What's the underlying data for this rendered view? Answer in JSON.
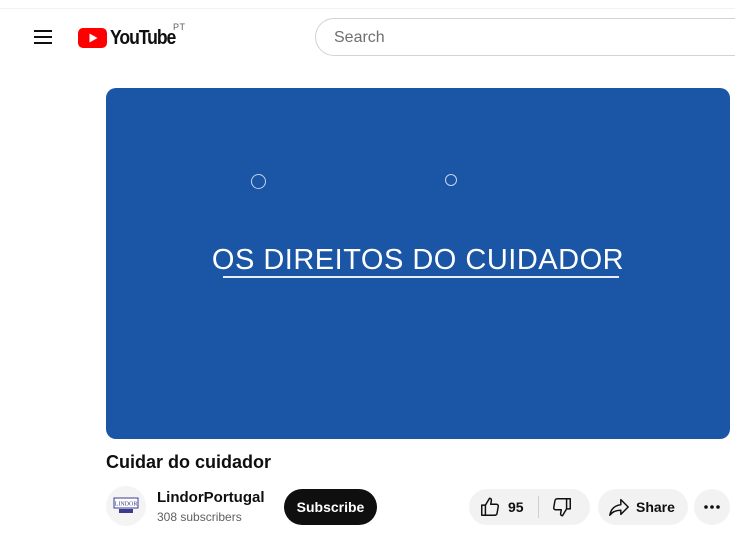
{
  "header": {
    "logo_text": "YouTube",
    "country_code": "PT",
    "search_placeholder": "Search",
    "brand_color": "#ff0000"
  },
  "video": {
    "overlay_text": "OS DIREITOS DO CUIDADOR",
    "background_color": "#1a55a6",
    "title": "Cuidar do cuidador"
  },
  "channel": {
    "name": "LindorPortugal",
    "subscribers": "308 subscribers",
    "avatar_text": "LINDOR"
  },
  "actions": {
    "subscribe_label": "Subscribe",
    "like_count": "95",
    "share_label": "Share"
  },
  "icons": {
    "menu": "hamburger-menu-icon",
    "like": "thumbs-up-icon",
    "dislike": "thumbs-down-icon",
    "share": "share-arrow-icon",
    "more": "more-horizontal-icon"
  }
}
